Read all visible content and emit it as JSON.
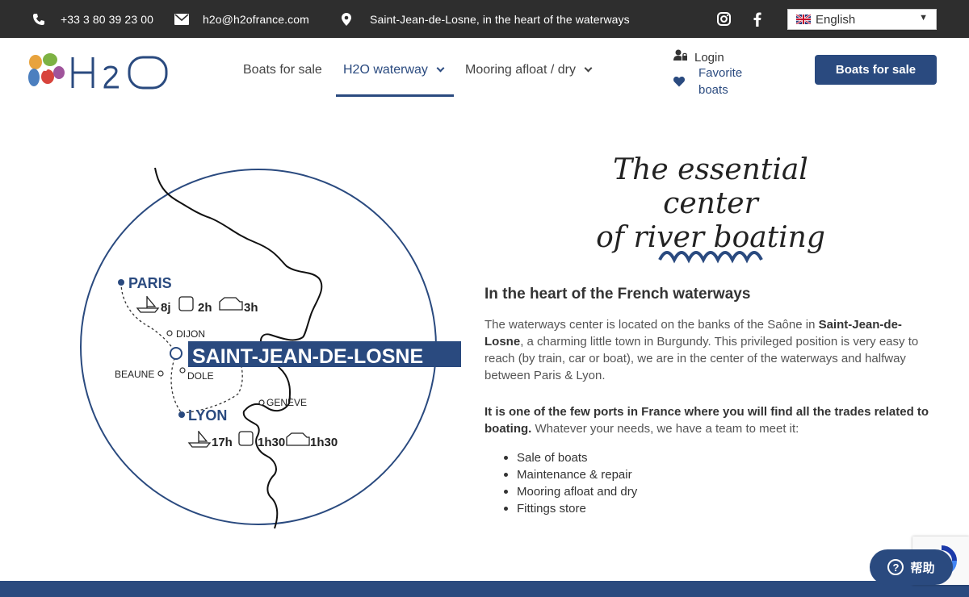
{
  "topbar": {
    "phone": "+33 3 80 39 23 00",
    "email": "h2o@h2ofrance.com",
    "location": "Saint-Jean-de-Losne, in the heart of the waterways",
    "language": "English"
  },
  "header": {
    "logo_text": "H2O",
    "nav": [
      {
        "label": "Boats for sale"
      },
      {
        "label": "H2O waterway"
      },
      {
        "label": "Mooring afloat / dry"
      }
    ],
    "login": "Login",
    "favorite": "Favorite boats",
    "cta": "Boats for sale"
  },
  "map": {
    "paris": "PARIS",
    "paris_boat": "8j",
    "paris_train": "2h",
    "paris_car": "3h",
    "dijon": "DIJON",
    "center": "SAINT-JEAN-DE-LOSNE",
    "beaune": "BEAUNE",
    "dole": "DOLE",
    "geneve": "GENÈVE",
    "lyon": "LYON",
    "lyon_boat": "17h",
    "lyon_train": "1h30",
    "lyon_car": "1h30"
  },
  "content": {
    "script_line1": "The essential center",
    "script_line2": "of river boating",
    "heading": "In the heart of the French waterways",
    "p1_a": "The waterways center is located on the banks of the Saône in ",
    "p1_b": "Saint-Jean-de-Losne",
    "p1_c": ", a charming little town in Burgundy. This privileged position is very easy to reach (by train, car or boat), we are in the center of the waterways and halfway between Paris & Lyon.",
    "p2_a": "It is one of the few ports in France where you will find all the trades related to boating.",
    "p2_b": " Whatever your needs, we have a team to meet it:",
    "list": [
      "Sale of boats",
      "Maintenance & repair",
      "Mooring afloat and dry",
      "Fittings store"
    ]
  },
  "widgets": {
    "help": "帮助"
  },
  "colors": {
    "brand": "#2a4a7f",
    "topbar": "#2e2e2e"
  }
}
